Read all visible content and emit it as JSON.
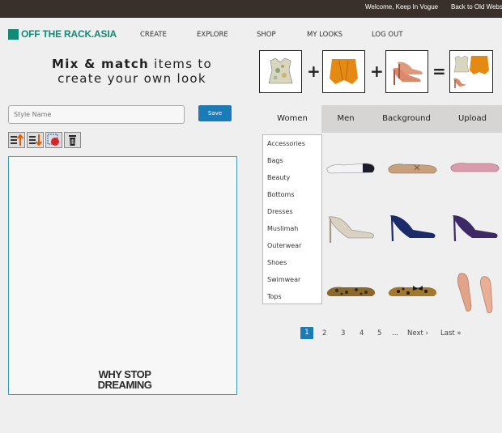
{
  "topbar": {
    "welcome": "Welcome, Keep In Vogue",
    "back": "Back to Old Webs"
  },
  "logo": {
    "text": "OFF THE RACK.ASIA",
    "color": "#138a76"
  },
  "nav": [
    "CREATE",
    "EXPLORE",
    "SHOP",
    "MY LOOKS",
    "LOG OUT"
  ],
  "tagline": {
    "bold": "Mix & match",
    "rest1": " items to",
    "line2": "create your own look"
  },
  "formula": {
    "plus": "+",
    "equals": "="
  },
  "style_form": {
    "placeholder": "Style Name",
    "save": "Save"
  },
  "tools": [
    "bring-forward-icon",
    "send-backward-icon",
    "clone-icon",
    "trash-icon"
  ],
  "canvas": {
    "brand_line1": "WHY STOP",
    "brand_line2": "DREAMING"
  },
  "tabs": [
    "Women",
    "Men",
    "Background",
    "Upload"
  ],
  "categories": [
    "Accessories",
    "Bags",
    "Beauty",
    "Bottoms",
    "Dresses",
    "Muslimah",
    "Outerwear",
    "Shoes",
    "Swimwear",
    "Tops"
  ],
  "pagination": {
    "pages": [
      "1",
      "2",
      "3",
      "4",
      "5"
    ],
    "ellipsis": "...",
    "next": "Next ›",
    "last": "Last »",
    "current": "1"
  },
  "colors": {
    "topbar": "#3a302b",
    "accent": "#1a7bb6",
    "brand": "#138a76"
  }
}
